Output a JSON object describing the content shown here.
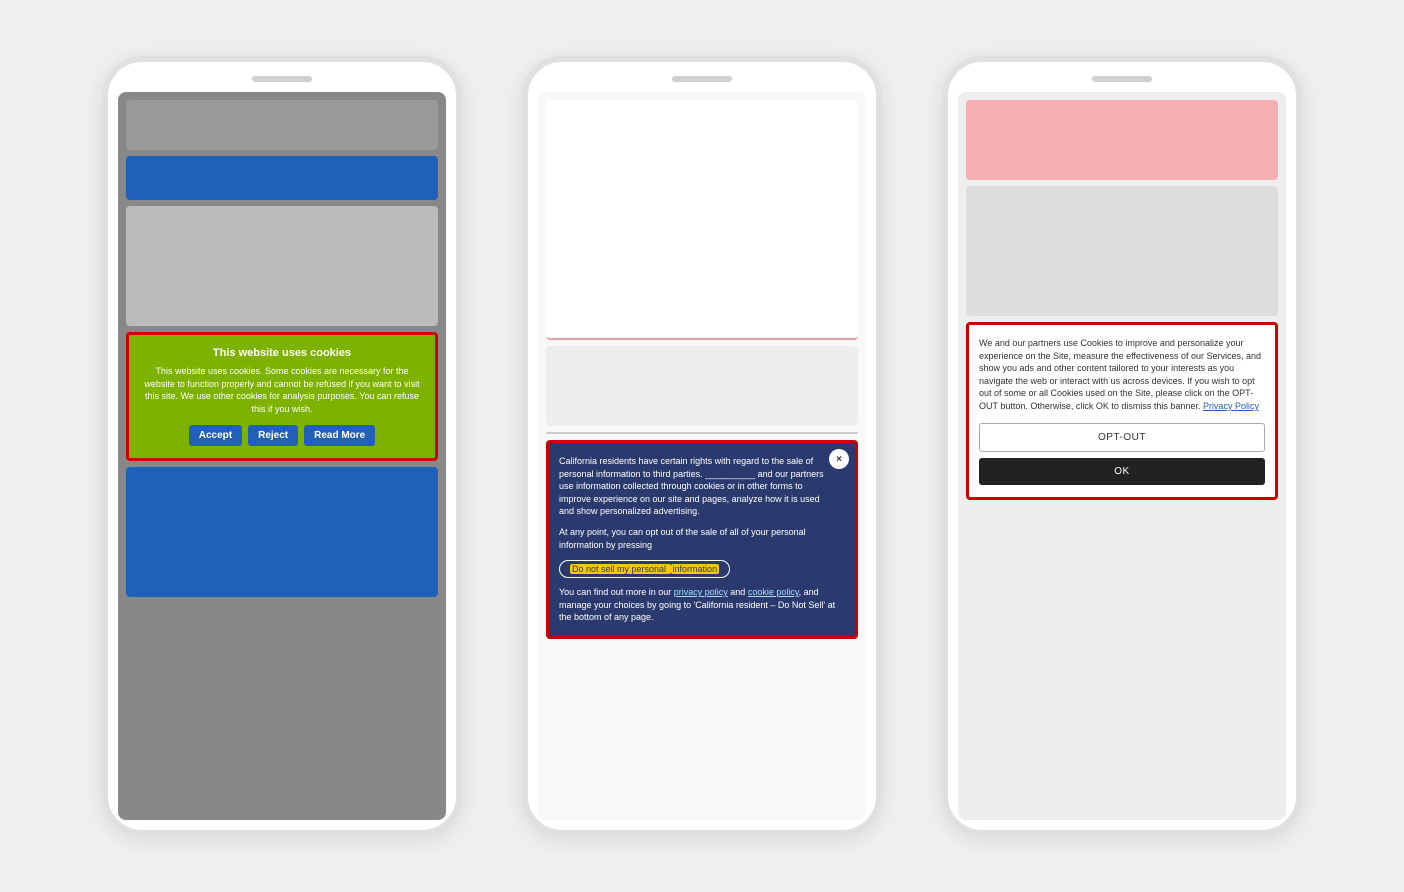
{
  "page": {
    "background": "#f0f0f0"
  },
  "phone1": {
    "cookie_banner": {
      "title": "This website uses cookies",
      "text": "This website uses cookies. Some cookies are necessary for the website to function properly and cannot be refused if you want to visit this site. We use other cookies for analysis purposes. You can refuse this if you wish.",
      "accept_label": "Accept",
      "reject_label": "Reject",
      "read_more_label": "Read More"
    }
  },
  "phone2": {
    "cookie_banner": {
      "close_label": "×",
      "paragraph1": "California residents have certain rights with regard to the sale of personal information to third parties. __________ and our partners use information collected through cookies or in other forms to improve experience on our site and pages, analyze how it is used and show personalized advertising.",
      "paragraph2": "At any point, you can opt out of the sale of all of your personal information by pressing",
      "opt_out_label": "Do not sell my personal information",
      "footer_text": "You can find out more in our privacy policy and cookie policy, and manage your choices by going to 'California resident – Do Not Sell' at the bottom of any page."
    }
  },
  "phone3": {
    "cookie_banner": {
      "text": "We and our partners use Cookies to improve and personalize your experience on the Site, measure the effectiveness of our Services, and show you ads and other content tailored to your interests as you navigate the web or interact with us across devices. If you wish to opt out of some or all Cookies used on the Site, please click on the OPT-OUT button. Otherwise, click OK to dismiss this banner.",
      "privacy_policy_label": "Privacy Policy",
      "opt_out_label": "OPT-OUT",
      "ok_label": "OK"
    }
  }
}
